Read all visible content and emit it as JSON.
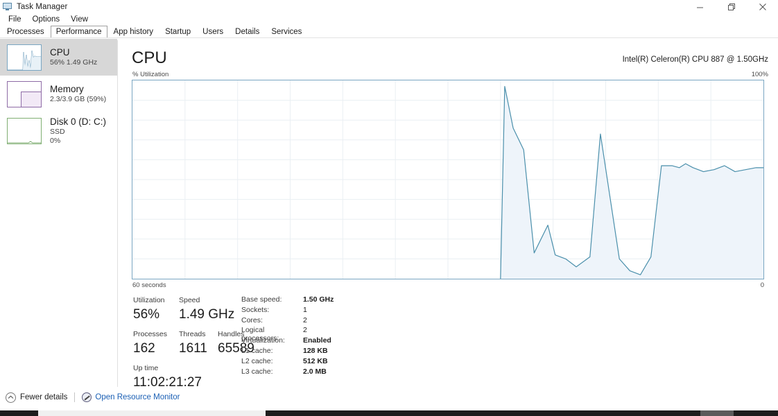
{
  "window": {
    "title": "Task Manager",
    "icon": "task-manager-icon",
    "controls": {
      "minimize": "minimize-icon",
      "maximize": "restore-icon",
      "close": "close-icon"
    }
  },
  "menu": {
    "items": [
      "File",
      "Options",
      "View"
    ]
  },
  "tabs": {
    "items": [
      {
        "label": "Processes",
        "selected": false
      },
      {
        "label": "Performance",
        "selected": true
      },
      {
        "label": "App history",
        "selected": false
      },
      {
        "label": "Startup",
        "selected": false
      },
      {
        "label": "Users",
        "selected": false
      },
      {
        "label": "Details",
        "selected": false
      },
      {
        "label": "Services",
        "selected": false
      }
    ]
  },
  "sidebar": {
    "items": [
      {
        "id": "cpu",
        "title": "CPU",
        "sub1": "56%  1.49 GHz",
        "sub2": "",
        "selected": true,
        "accent": "#7aa6c2"
      },
      {
        "id": "memory",
        "title": "Memory",
        "sub1": "2.3/3.9 GB (59%)",
        "sub2": "",
        "selected": false,
        "accent": "#8e6ba6"
      },
      {
        "id": "disk",
        "title": "Disk 0 (D: C:)",
        "sub1": "SSD",
        "sub2": "0%",
        "selected": false,
        "accent": "#7fae72"
      }
    ]
  },
  "main": {
    "heading": "CPU",
    "model": "Intel(R) Celeron(R) CPU 887 @ 1.50GHz",
    "graph_top_left_label": "% Utilization",
    "graph_top_right_label": "100%",
    "graph_bottom_left_label": "60 seconds",
    "graph_bottom_right_label": "0"
  },
  "chart_data": {
    "type": "area",
    "title": "% Utilization",
    "xlabel": "60 seconds",
    "ylabel": "% Utilization",
    "ylim": [
      0,
      100
    ],
    "xlim": [
      0,
      60
    ],
    "grid": true,
    "legend": null,
    "line_color": "#4a8fab",
    "fill_color": "#eef4fa",
    "x": [
      35.0,
      35.4,
      36.2,
      37.2,
      38.2,
      39.5,
      40.2,
      41.2,
      42.2,
      43.5,
      44.5,
      45.5,
      46.3,
      47.3,
      48.3,
      49.3,
      50.3,
      51.3,
      52.0,
      52.6,
      53.3,
      54.3,
      55.3,
      56.3,
      57.3,
      58.3,
      59.3,
      60.0
    ],
    "y": [
      0,
      97,
      76,
      65,
      13,
      27,
      12,
      10,
      6,
      11,
      73,
      38,
      10,
      4,
      2,
      11,
      57,
      57,
      56,
      58,
      56,
      54,
      55,
      57,
      54,
      55,
      56,
      56
    ],
    "series": [
      {
        "name": "CPU Utilization",
        "values": [
          0,
          97,
          76,
          65,
          13,
          27,
          12,
          10,
          6,
          11,
          73,
          38,
          10,
          4,
          2,
          11,
          57,
          57,
          56,
          58,
          56,
          54,
          55,
          57,
          54,
          55,
          56,
          56
        ]
      }
    ]
  },
  "stats": {
    "left": {
      "utilization_caption": "Utilization",
      "utilization_value": "56%",
      "speed_caption": "Speed",
      "speed_value": "1.49 GHz",
      "processes_caption": "Processes",
      "processes_value": "162",
      "threads_caption": "Threads",
      "threads_value": "1611",
      "handles_caption": "Handles",
      "handles_value": "65589",
      "uptime_caption": "Up time",
      "uptime_value": "11:02:21:27"
    },
    "right": [
      {
        "key": "Base speed:",
        "value": "1.50 GHz",
        "bold": true
      },
      {
        "key": "Sockets:",
        "value": "1",
        "bold": false
      },
      {
        "key": "Cores:",
        "value": "2",
        "bold": false
      },
      {
        "key": "Logical processors:",
        "value": "2",
        "bold": false
      },
      {
        "key": "Virtualization:",
        "value": "Enabled",
        "bold": true
      },
      {
        "key": "L1 cache:",
        "value": "128 KB",
        "bold": true
      },
      {
        "key": "L2 cache:",
        "value": "512 KB",
        "bold": true
      },
      {
        "key": "L3 cache:",
        "value": "2.0 MB",
        "bold": true
      }
    ]
  },
  "statusbar": {
    "fewer_details": "Fewer details",
    "fewer_details_icon": "chevron-up-circle-icon",
    "resource_monitor": "Open Resource Monitor",
    "resource_monitor_icon": "resource-monitor-icon"
  }
}
